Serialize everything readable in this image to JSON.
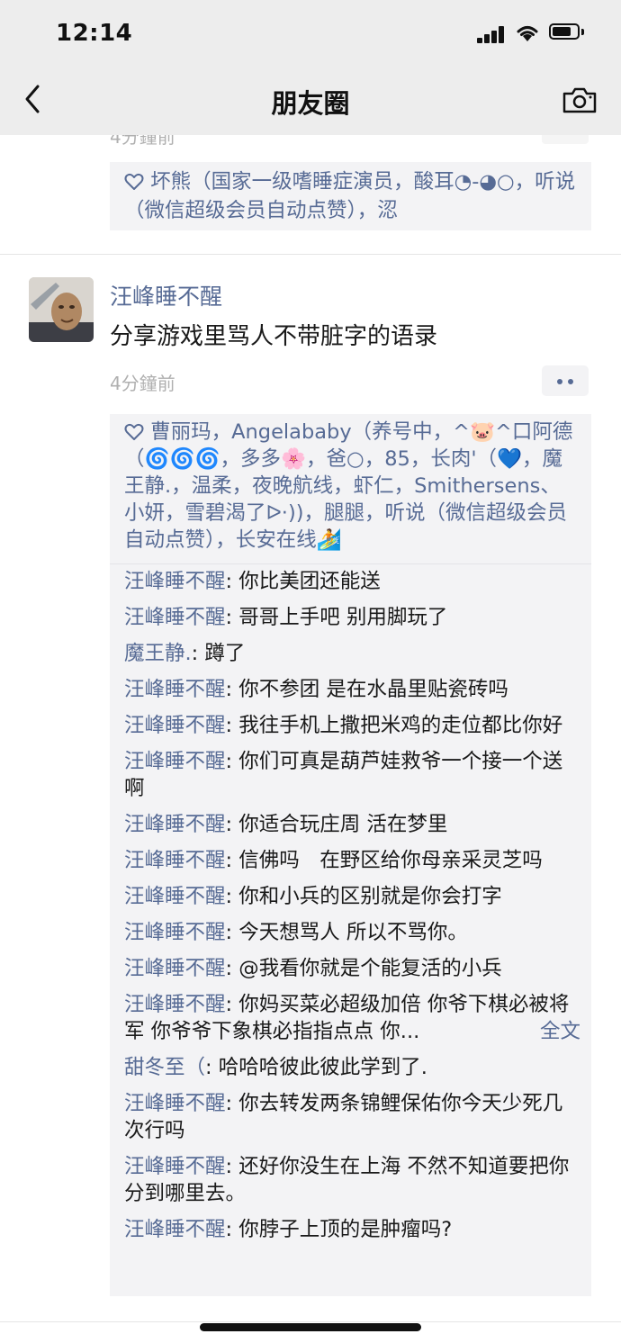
{
  "status_bar": {
    "time": "12:14"
  },
  "nav": {
    "title": "朋友圈"
  },
  "previous_post": {
    "time": "4分鐘前",
    "likes": "坏熊（国家一级嗜睡症演员，酸耳◔-◕○，听说（微信超级会员自动点赞），涊"
  },
  "post": {
    "author": "汪峰睡不醒",
    "text": "分享游戏里骂人不带脏字的语录",
    "time": "4分鐘前",
    "likes": "曹丽玛，Angelababy（养号中，^🐷^口阿德（🌀🌀🌀，多多🌸，爸○，85，长肉'（💙，魔王静.，温柔，夜晚航线，虾仁，Smithersens、小妍，雪碧渴了ᐅ·))，腿腿，听说（微信超级会员自动点赞），长安在线🏄",
    "comments": [
      {
        "name": "汪峰睡不醒",
        "text": "你比美团还能送"
      },
      {
        "name": "汪峰睡不醒",
        "text": "哥哥上手吧 别用脚玩了"
      },
      {
        "name": "魔王静.",
        "text": "蹲了"
      },
      {
        "name": "汪峰睡不醒",
        "text": "你不参团 是在水晶里贴瓷砖吗"
      },
      {
        "name": "汪峰睡不醒",
        "text": "我往手机上撒把米鸡的走位都比你好"
      },
      {
        "name": "汪峰睡不醒",
        "text": "你们可真是葫芦娃救爷一个接一个送啊"
      },
      {
        "name": "汪峰睡不醒",
        "text": "你适合玩庄周 活在梦里"
      },
      {
        "name": "汪峰睡不醒",
        "text": "信佛吗　在野区给你母亲采灵芝吗"
      },
      {
        "name": "汪峰睡不醒",
        "text": "你和小兵的区别就是你会打字"
      },
      {
        "name": "汪峰睡不醒",
        "text": "今天想骂人 所以不骂你。"
      },
      {
        "name": "汪峰睡不醒",
        "text": "@我看你就是个能复活的小兵"
      },
      {
        "name": "汪峰睡不醒",
        "text": "你妈买菜必超级加倍 你爷下棋必被将军 你爷爷下象棋必指指点点 你...",
        "full_label": "全文"
      },
      {
        "name": "甜冬至（",
        "text": "哈哈哈彼此彼此学到了."
      },
      {
        "name": "汪峰睡不醒",
        "text": "你去转发两条锦鲤保佑你今天少死几次行吗"
      },
      {
        "name": "汪峰睡不醒",
        "text": "还好你没生在上海 不然不知道要把你分到哪里去。"
      },
      {
        "name": "汪峰睡不醒",
        "text": "你脖子上顶的是肿瘤吗?"
      }
    ]
  },
  "colors": {
    "link": "#576b95",
    "bar": "#ededed",
    "panel": "#f3f3f5"
  }
}
